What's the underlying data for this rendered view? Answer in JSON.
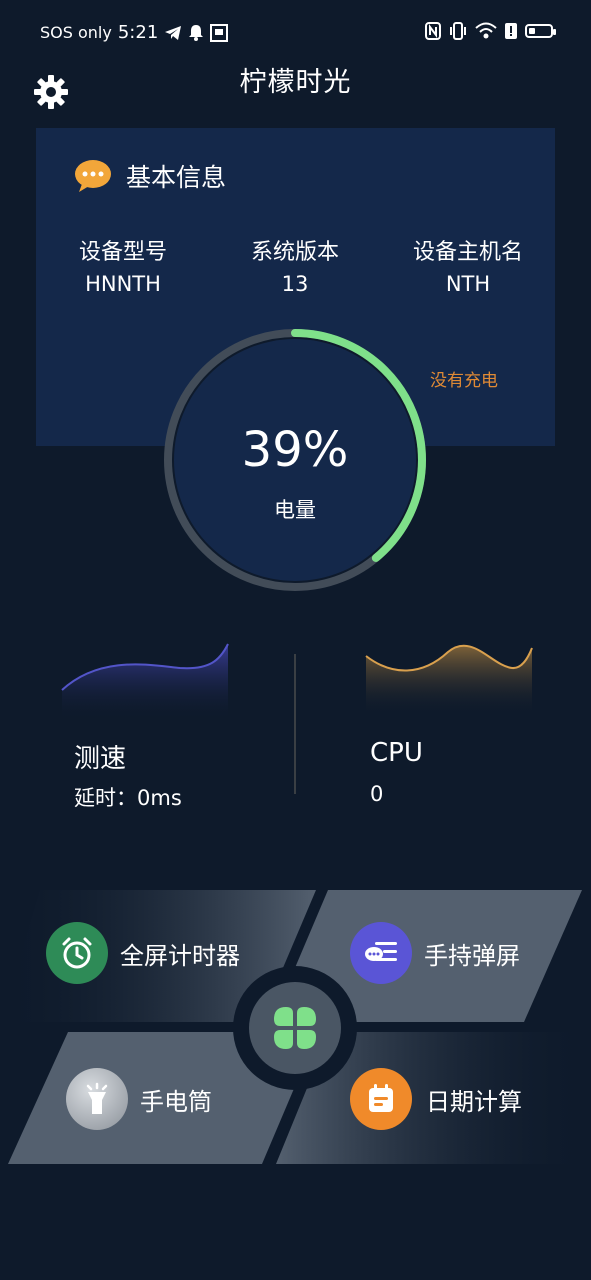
{
  "status_bar": {
    "carrier": "SOS only",
    "time": "5:21",
    "icons": [
      "telegram-icon",
      "bell-icon",
      "app-icon",
      "nfc-icon",
      "vibrate-icon",
      "wifi-icon",
      "alert-icon",
      "battery-icon"
    ]
  },
  "header": {
    "title": "柠檬时光",
    "settings_icon": "gear-icon"
  },
  "info_card": {
    "title": "基本信息",
    "icon": "chat-bubble-icon",
    "columns": [
      {
        "label": "设备型号",
        "value": "HNNTH"
      },
      {
        "label": "系统版本",
        "value": "13"
      },
      {
        "label": "设备主机名",
        "value": "NTH"
      }
    ],
    "charge_status": "没有充电"
  },
  "battery": {
    "percent_text": "39%",
    "level": 0.39,
    "label": "电量"
  },
  "stats": {
    "speed": {
      "title": "测速",
      "sub": "延时：0ms"
    },
    "cpu": {
      "title": "CPU",
      "sub": "0"
    }
  },
  "tools": [
    {
      "label": "全屏计时器",
      "icon": "alarm-clock-icon",
      "color": "#2e8b57"
    },
    {
      "label": "手持弹屏",
      "icon": "message-icon",
      "color": "#5a55d6"
    },
    {
      "label": "手电筒",
      "icon": "flashlight-icon",
      "color": "#9aa0a8"
    },
    {
      "label": "日期计算",
      "icon": "calendar-icon",
      "color": "#f08a2a"
    }
  ],
  "center_icon": "clover-icon",
  "colors": {
    "background": "#0e1a2b",
    "card": "#14284a",
    "gauge_track": "#424c58",
    "gauge_fill": "#7fe08a",
    "charge_status": "#e08a35"
  }
}
